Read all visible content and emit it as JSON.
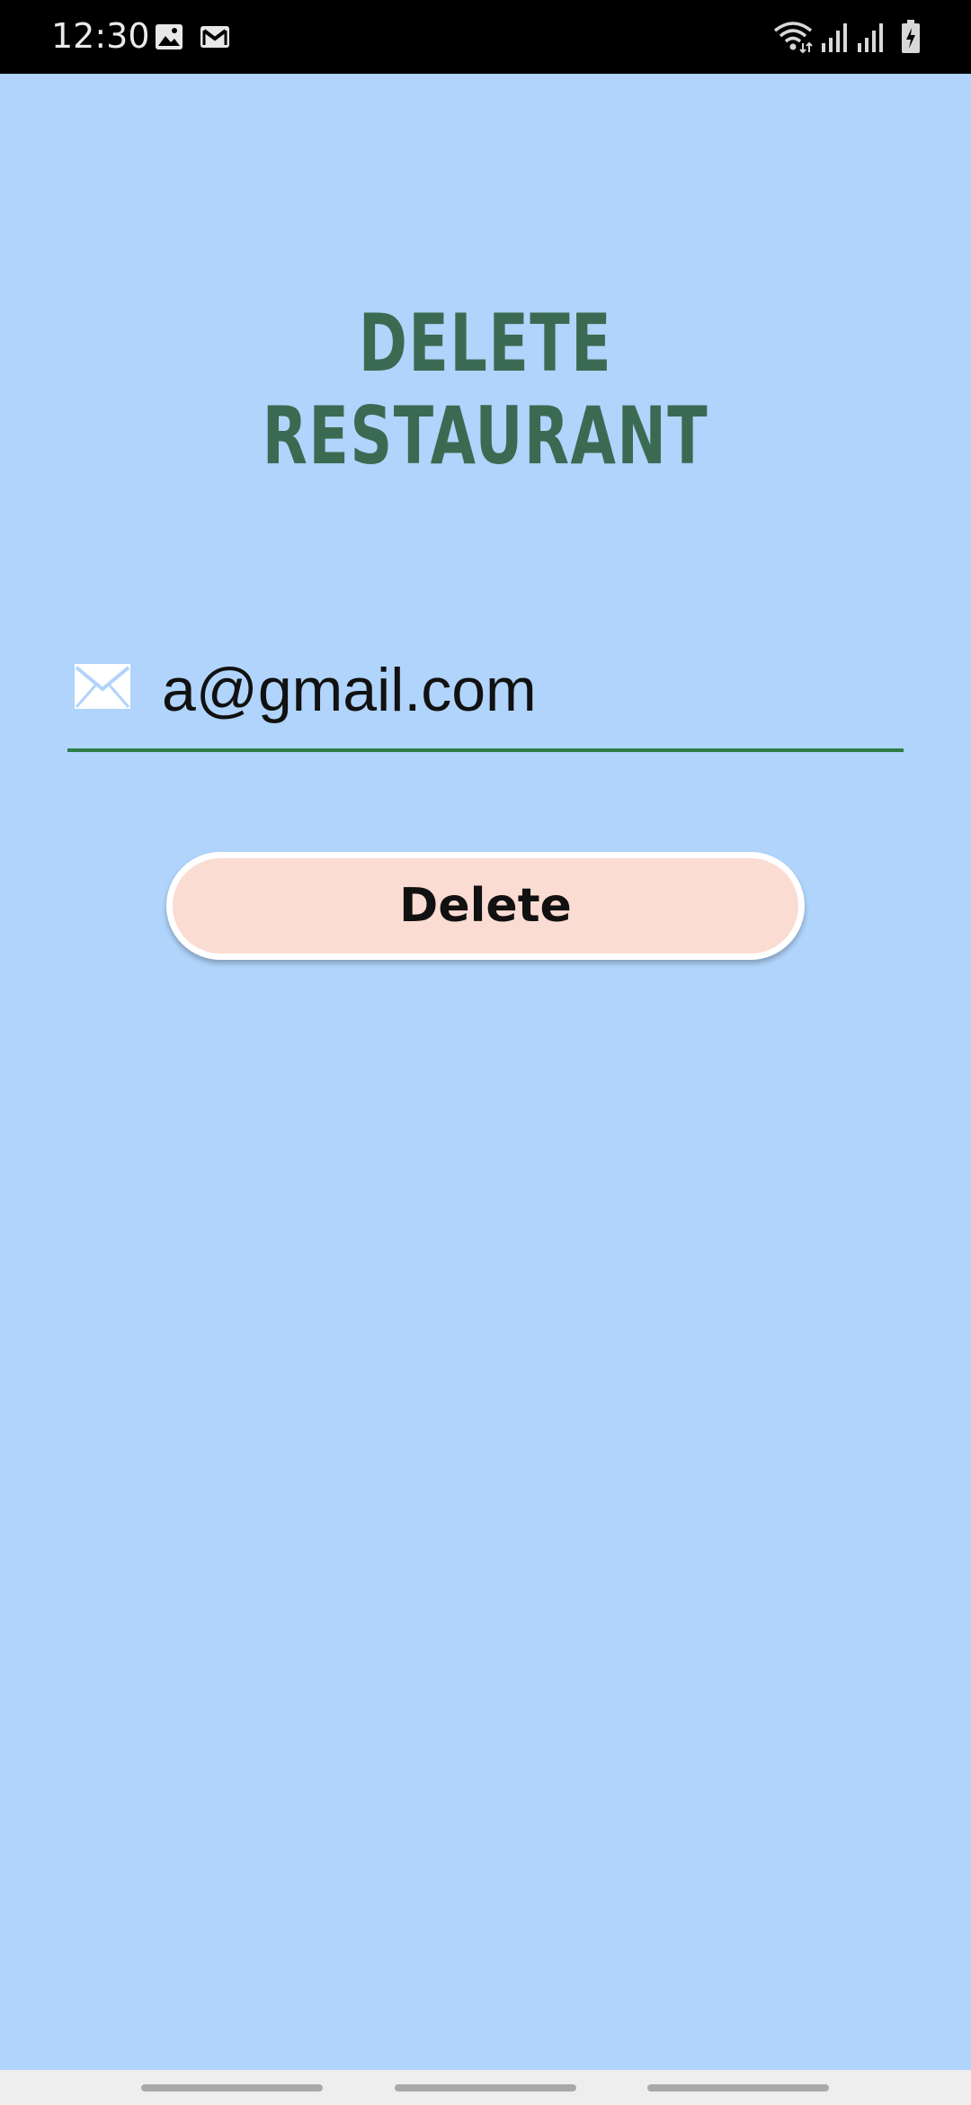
{
  "status_bar": {
    "time": "12:30",
    "icons": [
      "image-icon",
      "gmail-icon",
      "wifi-icon",
      "signal-icon",
      "signal-icon-2",
      "battery-charging-icon"
    ]
  },
  "page": {
    "title": "DELETE RESTAURANT"
  },
  "email_field": {
    "icon": "mail-icon",
    "value": "a@gmail.com"
  },
  "delete_button": {
    "label": "Delete"
  },
  "colors": {
    "background": "#b0d4fb",
    "title": "#3b6a52",
    "underline": "#2e7d46",
    "button_fill": "#fbdcd3"
  }
}
